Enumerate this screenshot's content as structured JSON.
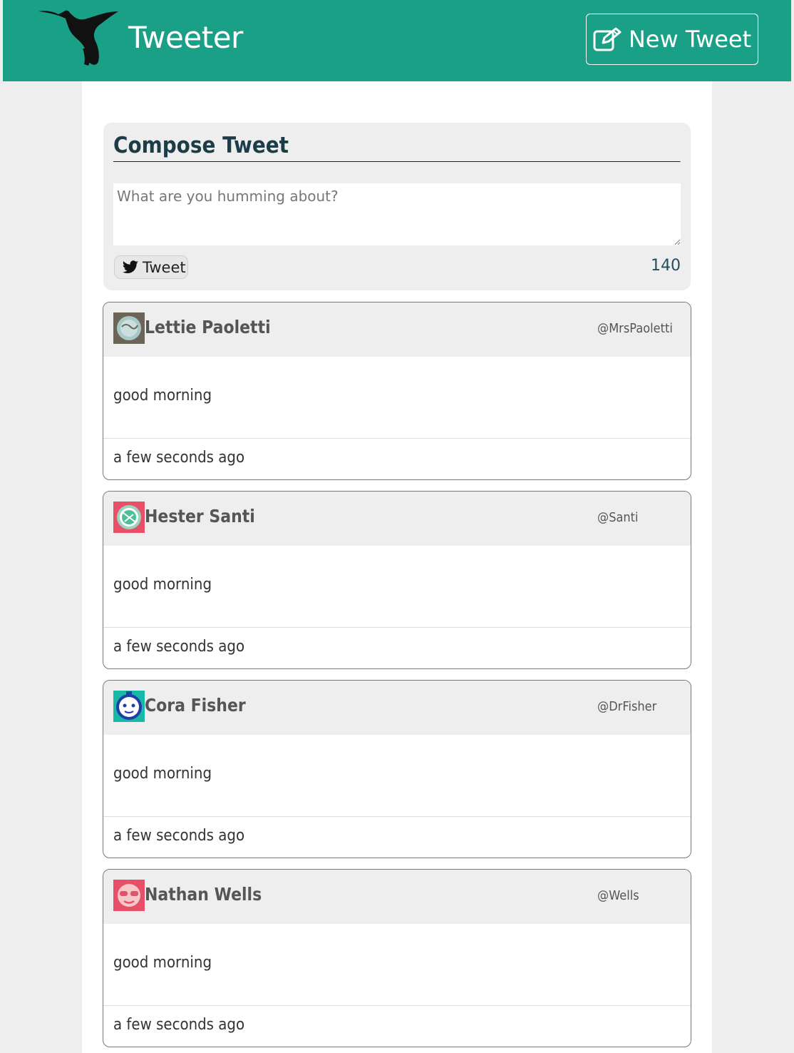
{
  "nav": {
    "brand": "Tweeter",
    "new_tweet_label": "New Tweet",
    "accent_color": "#1aa086"
  },
  "compose": {
    "title": "Compose Tweet",
    "placeholder": "What are you humming about?",
    "tweet_button_label": "Tweet",
    "counter": "140"
  },
  "tweets": [
    {
      "name": "Lettie Paoletti",
      "handle": "@MrsPaoletti",
      "body": "good morning",
      "time": "a few seconds ago",
      "avatar_color": "#6b6457",
      "avatar_icon": "avatar-lettie-icon"
    },
    {
      "name": "Hester Santi",
      "handle": "@Santi",
      "body": "good morning",
      "time": "a few seconds ago",
      "avatar_color": "#e8506a",
      "avatar_icon": "avatar-hester-icon"
    },
    {
      "name": "Cora Fisher",
      "handle": "@DrFisher",
      "body": "good morning",
      "time": "a few seconds ago",
      "avatar_color": "#17b8a6",
      "avatar_icon": "avatar-cora-icon"
    },
    {
      "name": "Nathan Wells",
      "handle": "@Wells",
      "body": "good morning",
      "time": "a few seconds ago",
      "avatar_color": "#e8506a",
      "avatar_icon": "avatar-nathan-icon"
    }
  ]
}
